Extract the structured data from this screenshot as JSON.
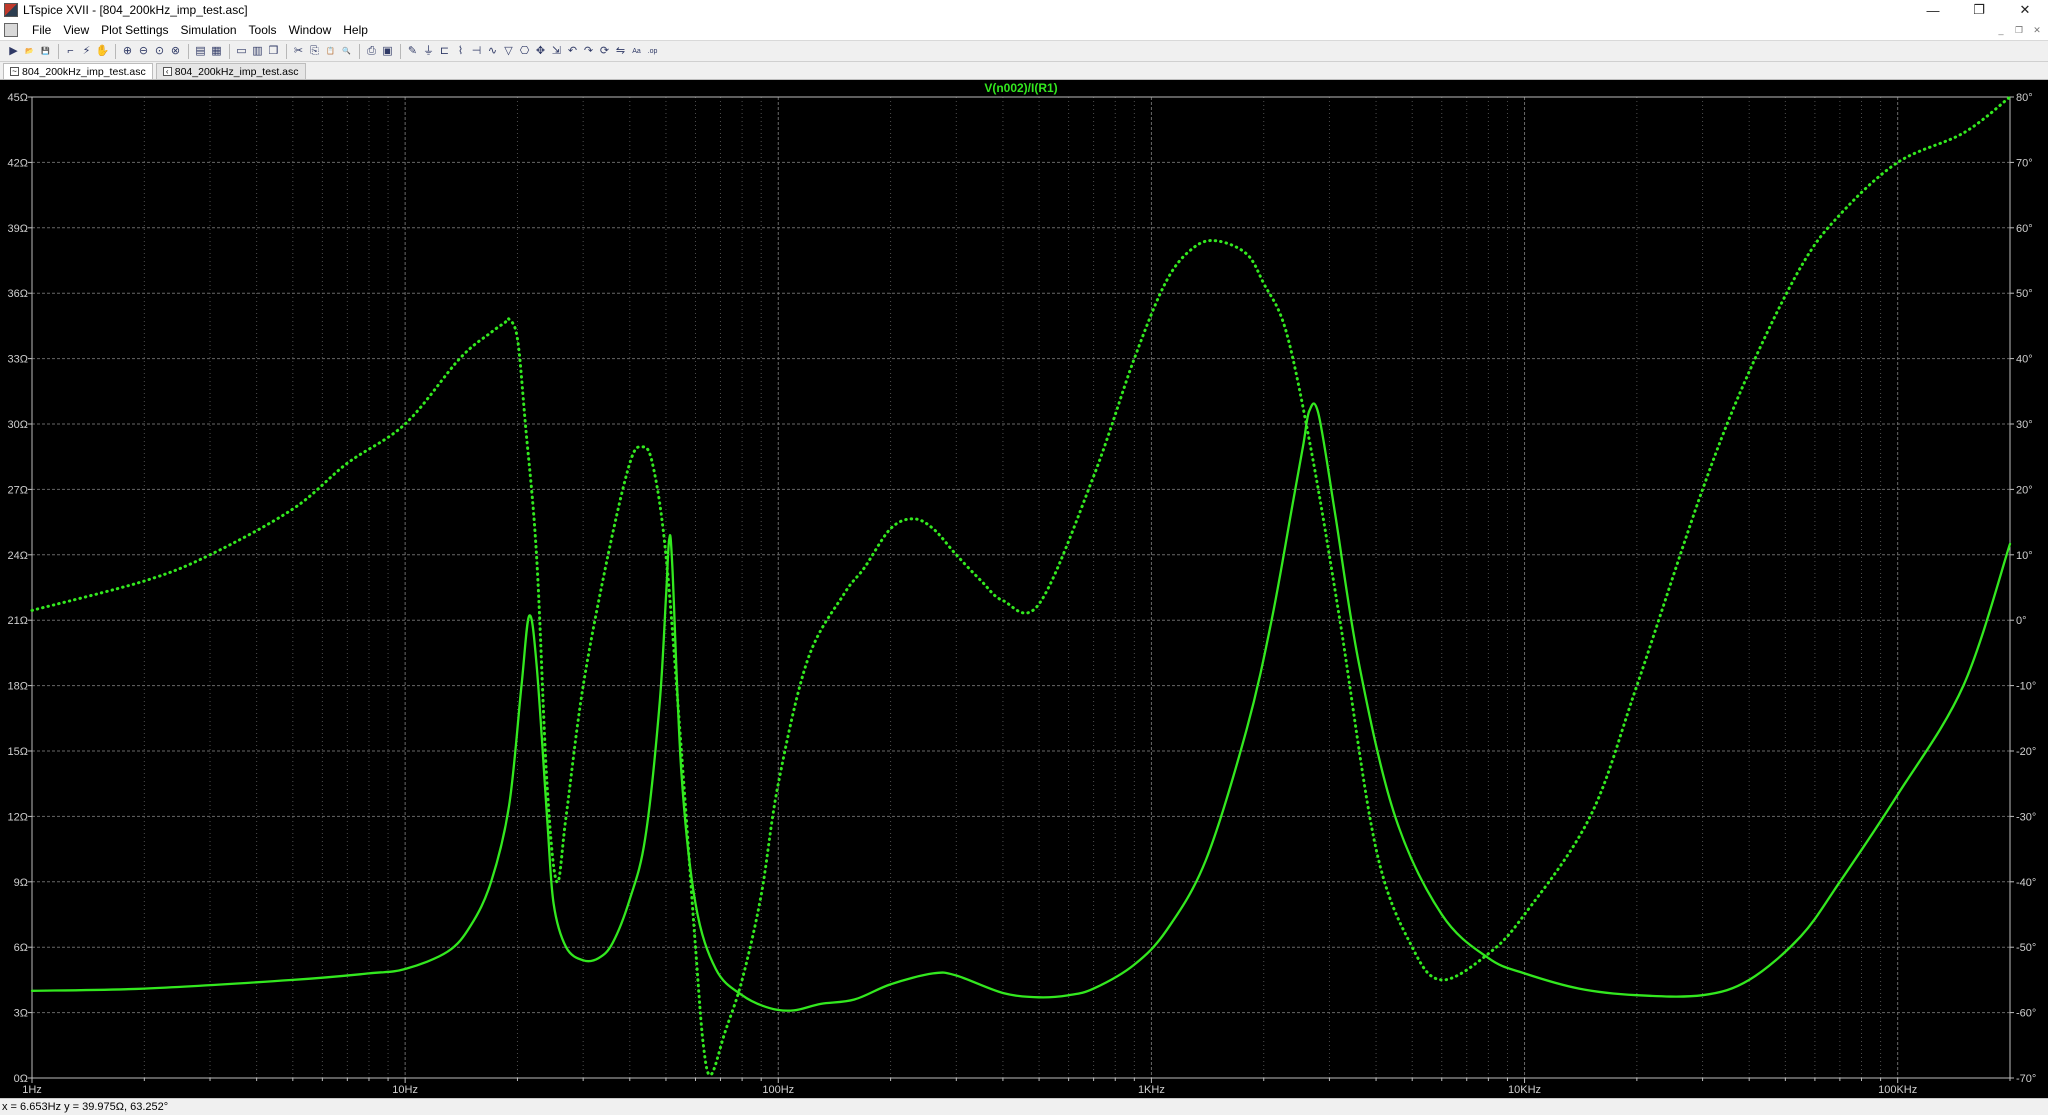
{
  "window": {
    "title": "LTspice XVII - [804_200kHz_imp_test.asc]",
    "minimize": "—",
    "restore": "❐",
    "close": "✕",
    "mdi_minimize": "_",
    "mdi_restore": "❐",
    "mdi_close": "✕"
  },
  "menu": [
    "File",
    "View",
    "Plot Settings",
    "Simulation",
    "Tools",
    "Window",
    "Help"
  ],
  "toolbar": {
    "groups": [
      [
        {
          "icon": "run-icon",
          "glyph": "▶"
        },
        {
          "icon": "open-icon",
          "glyph": "📂"
        },
        {
          "icon": "save-icon",
          "glyph": "💾"
        }
      ],
      [
        {
          "icon": "probe-icon",
          "glyph": "⌐"
        },
        {
          "icon": "halt-icon",
          "glyph": "⚡"
        },
        {
          "icon": "hand-icon",
          "glyph": "✋"
        }
      ],
      [
        {
          "icon": "zoom-in-icon",
          "glyph": "⊕"
        },
        {
          "icon": "zoom-out-icon",
          "glyph": "⊖"
        },
        {
          "icon": "zoom-fit-icon",
          "glyph": "⊙"
        },
        {
          "icon": "zoom-cancel-icon",
          "glyph": "⊗"
        }
      ],
      [
        {
          "icon": "autorange-icon",
          "glyph": "▤"
        },
        {
          "icon": "grid-icon",
          "glyph": "▦"
        }
      ],
      [
        {
          "icon": "tile-horizontal-icon",
          "glyph": "▭"
        },
        {
          "icon": "tile-vertical-icon",
          "glyph": "▥"
        },
        {
          "icon": "cascade-icon",
          "glyph": "❒"
        }
      ],
      [
        {
          "icon": "cut-icon",
          "glyph": "✂"
        },
        {
          "icon": "copy-icon",
          "glyph": "⎘"
        },
        {
          "icon": "paste-icon",
          "glyph": "📋"
        },
        {
          "icon": "find-icon",
          "glyph": "🔍"
        }
      ],
      [
        {
          "icon": "print-icon",
          "glyph": "⎙"
        },
        {
          "icon": "print-setup-icon",
          "glyph": "▣"
        }
      ],
      [
        {
          "icon": "wire-icon",
          "glyph": "✎"
        },
        {
          "icon": "ground-icon",
          "glyph": "⏚"
        },
        {
          "icon": "label-icon",
          "glyph": "⊏"
        },
        {
          "icon": "resistor-icon",
          "glyph": "⌇"
        },
        {
          "icon": "capacitor-icon",
          "glyph": "⊣"
        },
        {
          "icon": "inductor-icon",
          "glyph": "∿"
        },
        {
          "icon": "diode-icon",
          "glyph": "▽"
        },
        {
          "icon": "component-icon",
          "glyph": "⎔"
        },
        {
          "icon": "move-icon",
          "glyph": "✥"
        },
        {
          "icon": "drag-icon",
          "glyph": "⇲"
        },
        {
          "icon": "undo-icon",
          "glyph": "↶"
        },
        {
          "icon": "redo-icon",
          "glyph": "↷"
        },
        {
          "icon": "rotate-icon",
          "glyph": "⟳"
        },
        {
          "icon": "mirror-icon",
          "glyph": "⇋"
        },
        {
          "icon": "text-icon",
          "glyph": "Aa"
        },
        {
          "icon": "spice-directive-icon",
          "glyph": ".op"
        }
      ]
    ]
  },
  "tabs": [
    {
      "label": "804_200kHz_imp_test.asc",
      "active": true,
      "icon": "waveform-icon"
    },
    {
      "label": "804_200kHz_imp_test.asc",
      "active": false,
      "icon": "schematic-icon"
    }
  ],
  "status": {
    "text": "x = 6.653Hz    y = 39.975Ω, 63.252°"
  },
  "chart_data": {
    "type": "line",
    "title": "V(n002)/I(R1)",
    "xscale": "log",
    "xlim": [
      1,
      200000
    ],
    "ylim_left": [
      0,
      45
    ],
    "ylim_right": [
      -70,
      80
    ],
    "xticks": [
      {
        "value": 1,
        "label": "1Hz"
      },
      {
        "value": 10,
        "label": "10Hz"
      },
      {
        "value": 100,
        "label": "100Hz"
      },
      {
        "value": 1000,
        "label": "1KHz"
      },
      {
        "value": 10000,
        "label": "10KHz"
      },
      {
        "value": 100000,
        "label": "100KHz"
      }
    ],
    "yticks_left": [
      {
        "value": 0,
        "label": "0Ω"
      },
      {
        "value": 3,
        "label": "3Ω"
      },
      {
        "value": 6,
        "label": "6Ω"
      },
      {
        "value": 9,
        "label": "9Ω"
      },
      {
        "value": 12,
        "label": "12Ω"
      },
      {
        "value": 15,
        "label": "15Ω"
      },
      {
        "value": 18,
        "label": "18Ω"
      },
      {
        "value": 21,
        "label": "21Ω"
      },
      {
        "value": 24,
        "label": "24Ω"
      },
      {
        "value": 27,
        "label": "27Ω"
      },
      {
        "value": 30,
        "label": "30Ω"
      },
      {
        "value": 33,
        "label": "33Ω"
      },
      {
        "value": 36,
        "label": "36Ω"
      },
      {
        "value": 39,
        "label": "39Ω"
      },
      {
        "value": 42,
        "label": "42Ω"
      },
      {
        "value": 45,
        "label": "45Ω"
      }
    ],
    "yticks_right": [
      {
        "value": -70,
        "label": "-70°"
      },
      {
        "value": -60,
        "label": "-60°"
      },
      {
        "value": -50,
        "label": "-50°"
      },
      {
        "value": -40,
        "label": "-40°"
      },
      {
        "value": -30,
        "label": "-30°"
      },
      {
        "value": -20,
        "label": "-20°"
      },
      {
        "value": -10,
        "label": "-10°"
      },
      {
        "value": 0,
        "label": "0°"
      },
      {
        "value": 10,
        "label": "10°"
      },
      {
        "value": 20,
        "label": "20°"
      },
      {
        "value": 30,
        "label": "30°"
      },
      {
        "value": 40,
        "label": "40°"
      },
      {
        "value": 50,
        "label": "50°"
      },
      {
        "value": 60,
        "label": "60°"
      },
      {
        "value": 70,
        "label": "70°"
      },
      {
        "value": 80,
        "label": "80°"
      }
    ],
    "grid": true,
    "colors": {
      "background": "#000000",
      "trace": "#33e81f",
      "grid": "#6e6e6e",
      "axis": "#bdbdbd",
      "text": "#cfcfcf"
    },
    "series": [
      {
        "axis": "left",
        "style": "solid",
        "x": [
          1,
          2,
          5,
          8,
          10,
          13,
          15,
          17,
          19,
          20.5,
          21.5,
          22.5,
          24,
          25,
          27,
          30,
          33,
          36,
          40,
          44,
          48,
          50,
          51,
          52,
          55,
          60,
          68,
          80,
          95,
          110,
          130,
          160,
          200,
          260,
          300,
          400,
          500,
          600,
          700,
          900,
          1100,
          1400,
          1800,
          2100,
          2400,
          2550,
          2650,
          2800,
          3100,
          3600,
          4500,
          6000,
          8000,
          10000,
          14000,
          20000,
          30000,
          40000,
          55000,
          70000,
          100000,
          150000,
          200000
        ],
        "y": [
          4.0,
          4.1,
          4.5,
          4.8,
          5.0,
          5.8,
          7.0,
          9.0,
          12.5,
          18.0,
          21.2,
          19.0,
          12.0,
          8.0,
          6.0,
          5.4,
          5.5,
          6.2,
          8.2,
          11.0,
          17.0,
          22.0,
          24.7,
          23.5,
          14.0,
          8.0,
          5.0,
          3.8,
          3.2,
          3.1,
          3.4,
          3.6,
          4.3,
          4.8,
          4.7,
          3.9,
          3.7,
          3.8,
          4.1,
          5.2,
          6.8,
          10.0,
          16.0,
          21.0,
          26.5,
          29.0,
          30.6,
          30.5,
          26.0,
          19.0,
          12.0,
          7.5,
          5.5,
          4.8,
          4.1,
          3.8,
          3.8,
          4.5,
          6.5,
          9.0,
          13.0,
          18.0,
          24.5
        ]
      },
      {
        "axis": "right",
        "style": "dotted",
        "x": [
          1,
          2,
          3,
          5,
          7,
          10,
          14,
          17,
          18.5,
          19,
          20,
          21,
          22.5,
          24,
          25.5,
          27,
          30,
          35,
          40,
          43,
          46,
          50,
          55,
          60,
          63,
          66,
          72,
          80,
          90,
          100,
          120,
          150,
          170,
          200,
          230,
          260,
          300,
          350,
          400,
          500,
          700,
          900,
          1100,
          1300,
          1500,
          1800,
          2000,
          2300,
          2700,
          3200,
          4000,
          5000,
          6000,
          8000,
          10000,
          15000,
          20000,
          30000,
          40000,
          55000,
          70000,
          100000,
          150000,
          200000
        ],
        "y": [
          1.5,
          6.0,
          10.0,
          17.0,
          24.0,
          30.0,
          40.0,
          44.0,
          45.5,
          46.0,
          43.0,
          30.0,
          10.0,
          -25.0,
          -40.0,
          -30.0,
          -10.0,
          10.0,
          24.0,
          26.5,
          24.0,
          10.0,
          -20.0,
          -50.0,
          -65.0,
          -69.5,
          -63.0,
          -55.0,
          -42.0,
          -25.0,
          -6.0,
          4.0,
          8.0,
          14.0,
          15.5,
          14.0,
          10.0,
          6.0,
          3.0,
          2.5,
          22.0,
          40.0,
          52.0,
          57.0,
          58.0,
          56.0,
          51.5,
          44.0,
          25.0,
          0.0,
          -35.0,
          -50.0,
          -55.0,
          -51.0,
          -45.0,
          -30.0,
          -10.0,
          20.0,
          38.0,
          54.0,
          62.0,
          70.0,
          74.5,
          80.0
        ]
      }
    ]
  }
}
